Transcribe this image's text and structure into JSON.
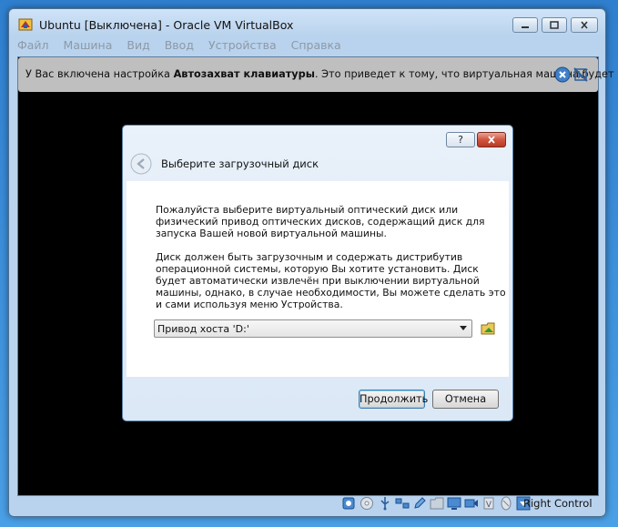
{
  "window": {
    "title": "Ubuntu [Выключена] - Oracle VM VirtualBox"
  },
  "menu": {
    "items": [
      "Файл",
      "Машина",
      "Вид",
      "Ввод",
      "Устройства",
      "Справка"
    ]
  },
  "notice": {
    "text_before": "У Вас включена настройка ",
    "text_bold": "Автозахват клавиатуры",
    "text_after": ". Это приведет к тому, что виртуальная машина будет"
  },
  "dialog": {
    "help_label": "?",
    "title": "Выберите загрузочный диск",
    "paragraph1": "Пожалуйста выберите виртуальный оптический диск или физический привод оптических дисков, содержащий диск для запуска Вашей новой виртуальной машины.",
    "paragraph2": "Диск должен быть загрузочным и содержать дистрибутив операционной системы, которую Вы хотите установить. Диск будет автоматически извлечён при выключении виртуальной машины, однако, в случае необходимости, Вы можете сделать это и сами используя меню Устройства.",
    "combo_value": "Привод хоста 'D:'",
    "continue_label": "Продолжить",
    "cancel_label": "Отмена"
  },
  "statusbar": {
    "host_key": "Right Control",
    "icons": [
      "hard-disk-icon",
      "optical-disk-icon",
      "usb-icon",
      "network-icon",
      "pencil-icon",
      "shared-folder-icon",
      "display-icon",
      "video-capture-icon",
      "cpu-icon",
      "mouse-icon",
      "keyboard-capture-icon"
    ]
  },
  "colors": {
    "desktop": "#3e8fd6",
    "window_frame": "#b9d3ee",
    "vm_screen": "#000000",
    "notice_bg": "#bfbfbf",
    "close_red": "#d1553f",
    "disabled_menu": "#8d99a6"
  }
}
